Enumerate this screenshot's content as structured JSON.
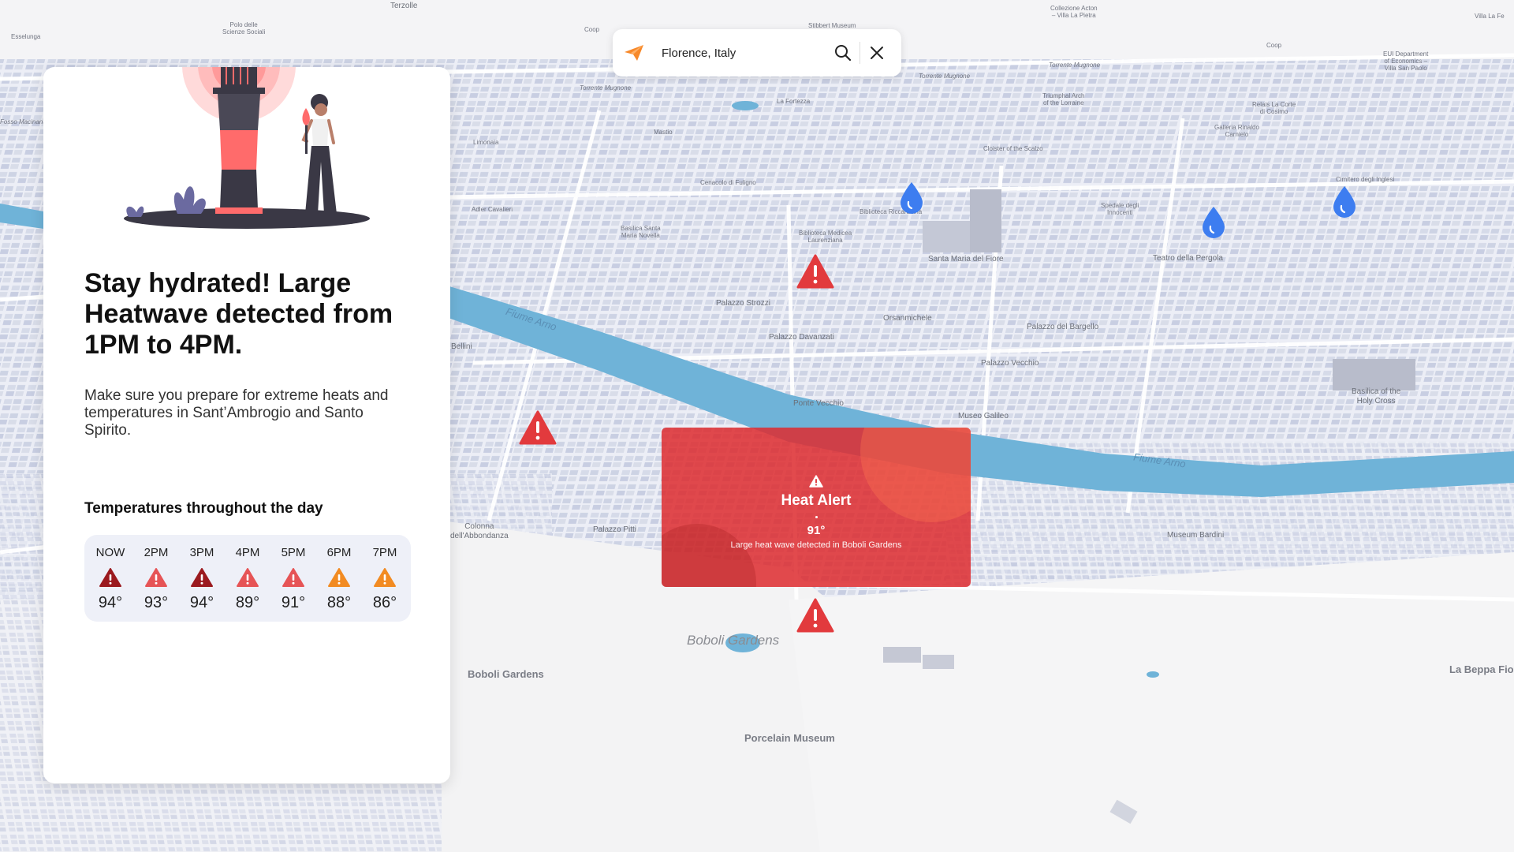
{
  "search": {
    "value": "Florence, Italy"
  },
  "panel": {
    "headline": "Stay hydrated! Large Heatwave detected from 1PM to 4PM.",
    "body": "Make sure you prepare for extreme heats and temperatures in Sant’Ambrogio and Santo Spirito.",
    "temps_title": "Temperatures throughout the day",
    "forecast": [
      {
        "time": "NOW",
        "temp": "94°",
        "level": "extreme",
        "color": "#9b1a1f"
      },
      {
        "time": "2PM",
        "temp": "93°",
        "level": "high",
        "color": "#e65456"
      },
      {
        "time": "3PM",
        "temp": "94°",
        "level": "extreme",
        "color": "#9b1a1f"
      },
      {
        "time": "4PM",
        "temp": "89°",
        "level": "high",
        "color": "#e65456"
      },
      {
        "time": "5PM",
        "temp": "91°",
        "level": "high",
        "color": "#e65456"
      },
      {
        "time": "6PM",
        "temp": "88°",
        "level": "moderate",
        "color": "#f28b22"
      },
      {
        "time": "7PM",
        "temp": "86°",
        "level": "moderate",
        "color": "#f28b22"
      }
    ]
  },
  "alert": {
    "title": "Heat Alert",
    "temp": "91°",
    "description": "Large heat wave detected in Boboli Gardens",
    "color": "#dd2c30"
  },
  "map": {
    "labels": {
      "terzolle": "Terzolle",
      "polo": "Polo delle\nScienze Sociali",
      "esselunga": "Esselunga",
      "coop1": "Coop",
      "stibbert": "Stibbert Museum",
      "acton": "Collezione Acton\n– Villa La Pietra",
      "villa_lai": "Villa La Fe",
      "coop2": "Coop",
      "eui": "EUI Department\nof Economics –\nVilla San Paolo",
      "torrente_mugnone1": "Torrente Mugnone",
      "torrente_mugnone2": "Torrente Mugnone",
      "torrente_mugnone3": "Torrente Mugnone",
      "fortezza": "La Fortezza",
      "triumphal": "Triumphal Arch\nof the Lorraine",
      "relais": "Relais La Corte\ndi Cosimo",
      "mastio": "Mastio",
      "galleria": "Galleria Rinaldo\nCarnielo",
      "fosso": "Fosso Macinante",
      "limonaia": "Limonaia",
      "chiostro": "Cloister of the Scalzo",
      "cenacolo": "Cenacolo di Fuligno",
      "cimitero": "Cimitero degli Inglesi",
      "adler": "Adler Cavalieri",
      "biblioteca_r": "Biblioteca Riccardiana",
      "spedale": "Spedale degli\nInnocenti",
      "basilica_smn": "Basilica Santa\nMaria Novella",
      "biblioteca_m": "Biblioteca Medicea\nLaurenziana",
      "santa_maria": "Santa Maria del Fiore",
      "teatro": "Teatro della Pergola",
      "fiume_arno1": "Fiume Arno",
      "fiume_arno2": "Fiume Arno",
      "palazzo_strozzi": "Palazzo Strozzi",
      "orsanmichele": "Orsanmichele",
      "bargello": "Palazzo del Bargello",
      "bellini": "Bellini",
      "davanzati": "Palazzo Davanzati",
      "vecchio": "Palazzo Vecchio",
      "basilica_hc": "Basilica of the\nHoly Cross",
      "ponte_vecchio": "Ponte Vecchio",
      "galileo": "Museo Galileo",
      "colonna": "Colonna\ndell'Abbondanza",
      "pitti": "Palazzo Pitti",
      "bardini": "Museum Bardini",
      "boboli_park": "Boboli Gardens",
      "boboli": "Boboli Gardens",
      "porcelain": "Porcelain Museum",
      "beppa": "La Beppa Fior"
    }
  }
}
